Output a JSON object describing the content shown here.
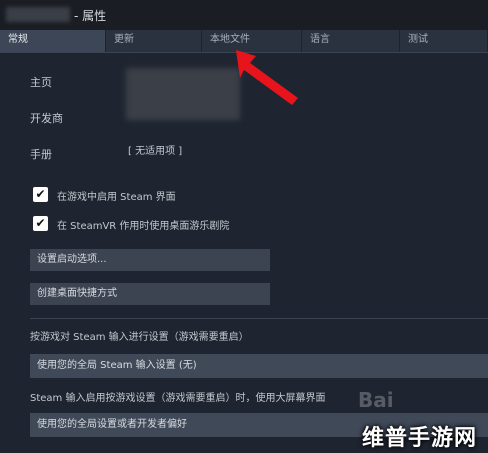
{
  "window": {
    "title_suffix": "- 属性"
  },
  "tabs": [
    {
      "label": "常规",
      "active": true
    },
    {
      "label": "更新",
      "active": false
    },
    {
      "label": "本地文件",
      "active": false
    },
    {
      "label": "语言",
      "active": false
    },
    {
      "label": "测试",
      "active": false
    }
  ],
  "fields": {
    "homepage_label": "主页",
    "developer_label": "开发商",
    "manual_label": "手册",
    "manual_value": "[ 无适用项 ]"
  },
  "checkboxes": [
    {
      "label": "在游戏中启用 Steam 界面",
      "checked": true
    },
    {
      "label": "在 SteamVR 作用时使用桌面游乐剧院",
      "checked": true
    }
  ],
  "buttons": {
    "launch_options": "设置启动选项...",
    "desktop_shortcut": "创建桌面快捷方式"
  },
  "input_settings": {
    "heading": "按游戏对 Steam 输入进行设置（游戏需要重启）",
    "dropdown_value": "使用您的全局 Steam 输入设置 (无)",
    "bigpicture_heading": "Steam 输入启用按游戏设置（游戏需要重启）时，使用大屏幕界面",
    "bigpicture_value": "使用您的全局设置或者开发者偏好"
  },
  "watermark": {
    "text": "维普手游网"
  },
  "colors": {
    "background": "#1f2530",
    "accent_arrow": "#e8141c",
    "tab_active": "#3c4656"
  }
}
